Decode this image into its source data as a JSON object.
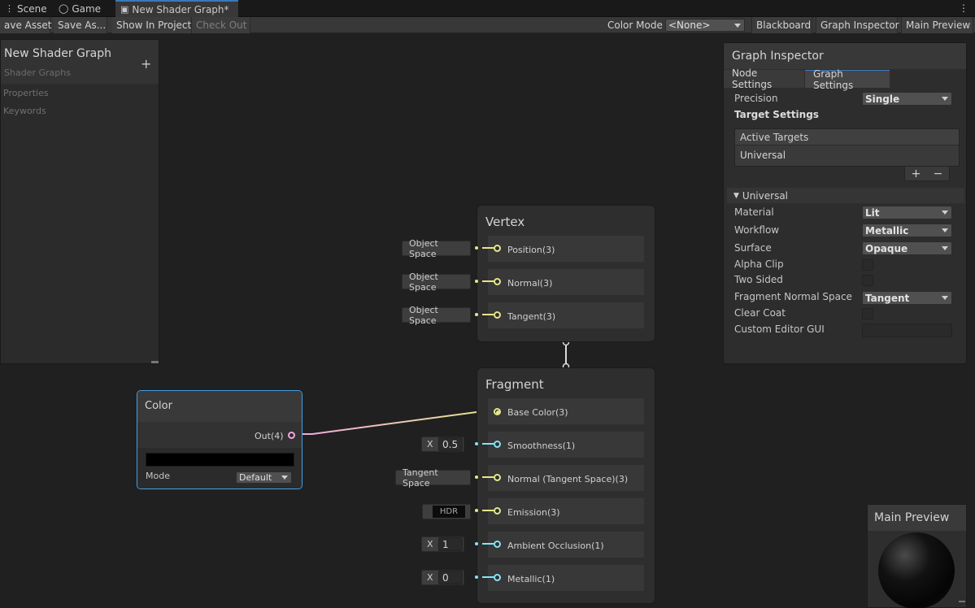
{
  "tabs": [
    {
      "label": "Scene",
      "icon": "scene-icon"
    },
    {
      "label": "Game",
      "icon": "game-icon"
    },
    {
      "label": "New Shader Graph*",
      "icon": "shader-graph-icon"
    }
  ],
  "toolbar": {
    "save_asset": "ave Asset",
    "save_as": "Save As...",
    "show_in_project": "Show In Project",
    "check_out": "Check Out",
    "color_mode_label": "Color Mode",
    "color_mode_value": "<None>",
    "blackboard": "Blackboard",
    "graph_inspector": "Graph Inspector",
    "main_preview": "Main Preview"
  },
  "blackboard": {
    "title": "New Shader Graph",
    "subtitle": "Shader Graphs",
    "add": "+",
    "categories": [
      "Properties",
      "Keywords"
    ]
  },
  "inspector": {
    "title": "Graph Inspector",
    "tabs": [
      "Node Settings",
      "Graph Settings"
    ],
    "active_tab": "Graph Settings",
    "precision_label": "Precision",
    "precision_value": "Single",
    "target_settings": "Target Settings",
    "active_targets_header": "Active Targets",
    "active_targets": [
      "Universal"
    ],
    "add": "+",
    "remove": "−",
    "section": "Universal",
    "properties": [
      {
        "label": "Material",
        "value": "Lit",
        "kind": "dropdown"
      },
      {
        "label": "Workflow",
        "value": "Metallic",
        "kind": "dropdown"
      },
      {
        "label": "Surface",
        "value": "Opaque",
        "kind": "dropdown"
      },
      {
        "label": "Alpha Clip",
        "value": "",
        "kind": "checkbox"
      },
      {
        "label": "Two Sided",
        "value": "",
        "kind": "checkbox"
      },
      {
        "label": "Fragment Normal Space",
        "value": "Tangent",
        "kind": "dropdown"
      },
      {
        "label": "Clear Coat",
        "value": "",
        "kind": "checkbox"
      },
      {
        "label": "Custom Editor GUI",
        "value": "",
        "kind": "text"
      }
    ]
  },
  "vertex": {
    "title": "Vertex",
    "slots": [
      {
        "label": "Position(3)",
        "input": "Object Space"
      },
      {
        "label": "Normal(3)",
        "input": "Object Space"
      },
      {
        "label": "Tangent(3)",
        "input": "Object Space"
      }
    ]
  },
  "fragment": {
    "title": "Fragment",
    "slots": [
      {
        "label": "Base Color(3)",
        "input": ""
      },
      {
        "label": "Smoothness(1)",
        "axis": "X",
        "input": "0.5"
      },
      {
        "label": "Normal (Tangent Space)(3)",
        "input": "Tangent Space"
      },
      {
        "label": "Emission(3)",
        "input": "HDR"
      },
      {
        "label": "Ambient Occlusion(1)",
        "axis": "X",
        "input": "1"
      },
      {
        "label": "Metallic(1)",
        "axis": "X",
        "input": "0"
      }
    ]
  },
  "color_node": {
    "title": "Color",
    "output": "Out(4)",
    "swatch": "#000000",
    "mode_label": "Mode",
    "mode_value": "Default"
  },
  "preview": {
    "title": "Main Preview"
  },
  "colors": {
    "vector3_port": "#e6e68c",
    "float_port": "#84e4f8",
    "vector4_port": "#f2a6e0",
    "selection": "#45a0e6",
    "tab_accent": "#3a79bb"
  }
}
